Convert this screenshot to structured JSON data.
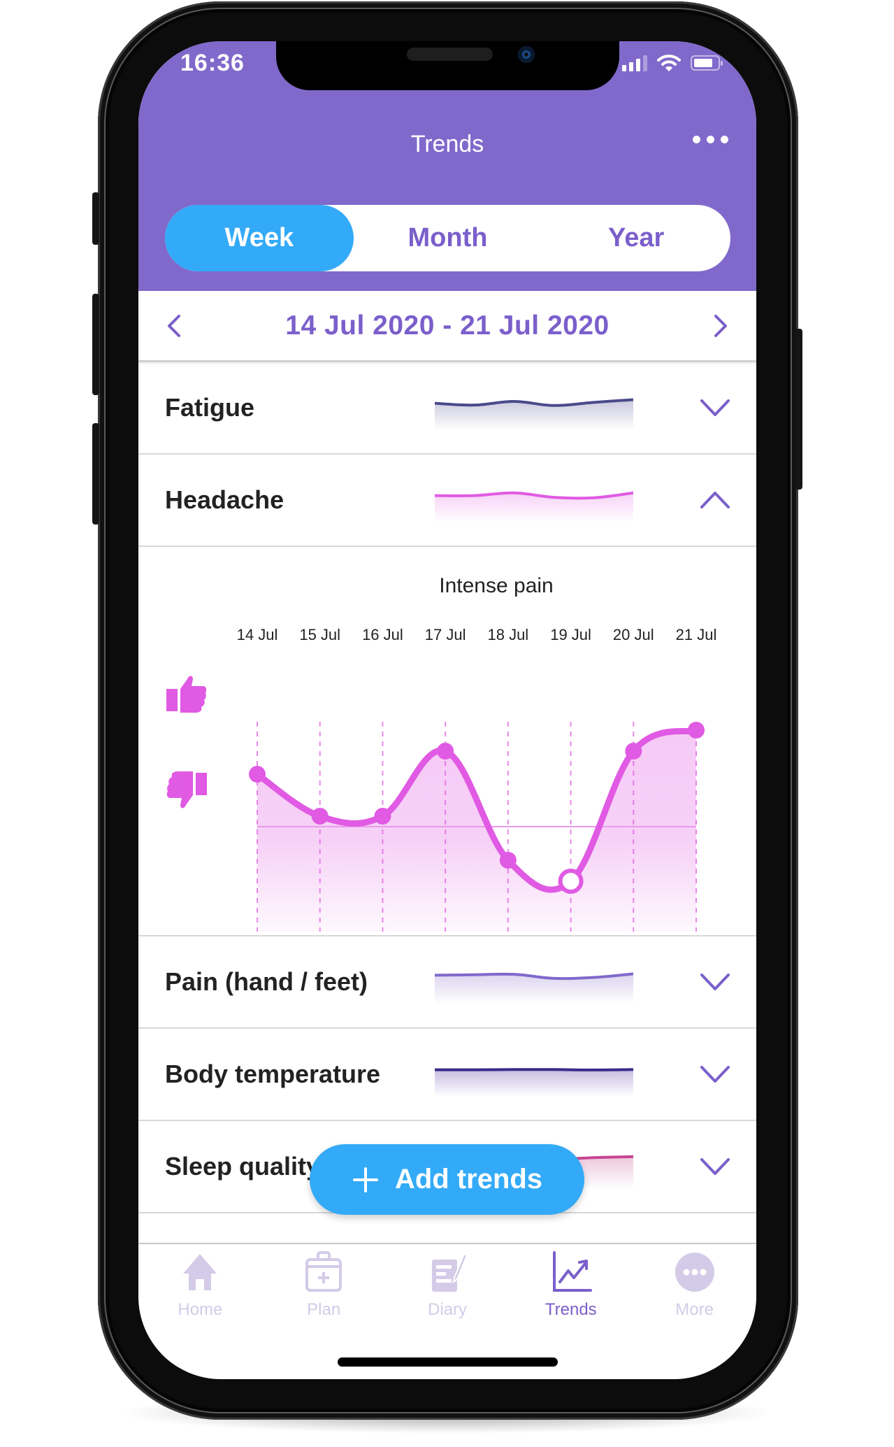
{
  "status_bar": {
    "time": "16:36",
    "signal_bars_on": 3,
    "signal_bars_total": 4,
    "battery_percent": 80
  },
  "header": {
    "title": "Trends",
    "more_icon": "more-horizontal-icon"
  },
  "segmented_control": {
    "options": [
      "Week",
      "Month",
      "Year"
    ],
    "selected": "Week"
  },
  "date_nav": {
    "range": "14 Jul 2020 - 21 Jul 2020",
    "prev_icon": "chevron-left-icon",
    "next_icon": "chevron-right-icon"
  },
  "trends": [
    {
      "label": "Fatigue",
      "expanded": false,
      "color": "#4a4a8a",
      "fill": "#c9c9de",
      "spark": [
        6,
        5.6,
        6.4,
        5.5,
        6.2,
        6.8
      ]
    },
    {
      "label": "Headache",
      "expanded": true,
      "color": "#e05ae3",
      "fill": "#f6d2f6",
      "spark": [
        6,
        6,
        6.6,
        5.6,
        5.5,
        6.6
      ]
    },
    {
      "label": "Pain (hand / feet)",
      "expanded": false,
      "color": "#8069cb",
      "fill": "#dcd4ef",
      "spark": [
        6.5,
        6.6,
        6.7,
        5.8,
        6,
        6.8
      ]
    },
    {
      "label": "Body temperature",
      "expanded": false,
      "color": "#3b2a8a",
      "fill": "#c6bde0",
      "spark": [
        6,
        6,
        6.05,
        6.05,
        5.95,
        6.05
      ]
    },
    {
      "label": "Sleep quality",
      "expanded": false,
      "color": "#c84591",
      "fill": "#ecc8dd",
      "spark": [
        5,
        5.5,
        6,
        6.5,
        7,
        7.2
      ]
    }
  ],
  "chart_data": {
    "type": "line",
    "title": "Intense pain",
    "categories": [
      "14 Jul",
      "15 Jul",
      "16 Jul",
      "17 Jul",
      "18 Jul",
      "19 Jul",
      "20 Jul",
      "21 Jul"
    ],
    "series": [
      {
        "name": "Headache",
        "values": [
          7.5,
          5.5,
          5.5,
          8.6,
          3.4,
          2.4,
          8.6,
          9.6
        ]
      }
    ],
    "baseline": 5,
    "ylim": [
      0,
      10
    ],
    "y_axis_icons": [
      "thumbs-up-icon",
      "thumbs-down-icon"
    ],
    "highlighted_index": 5,
    "color": "#e05ae3",
    "xlabel": "",
    "ylabel": "",
    "grid": "vertical-dashed"
  },
  "fab": {
    "label": "Add trends",
    "icon": "plus-icon"
  },
  "tab_bar": {
    "items": [
      {
        "label": "Home",
        "icon": "home-icon",
        "active": false
      },
      {
        "label": "Plan",
        "icon": "calendar-plus-icon",
        "active": false
      },
      {
        "label": "Diary",
        "icon": "diary-edit-icon",
        "active": false
      },
      {
        "label": "Trends",
        "icon": "trend-chart-icon",
        "active": true
      },
      {
        "label": "More",
        "icon": "more-circle-icon",
        "active": false
      }
    ]
  },
  "colors": {
    "header_purple": "#8069cb",
    "accent_blue": "#33aaf7",
    "text_purple": "#7b5fcb",
    "chart_magenta": "#e05ae3",
    "tab_inactive": "#d3cbe8"
  }
}
